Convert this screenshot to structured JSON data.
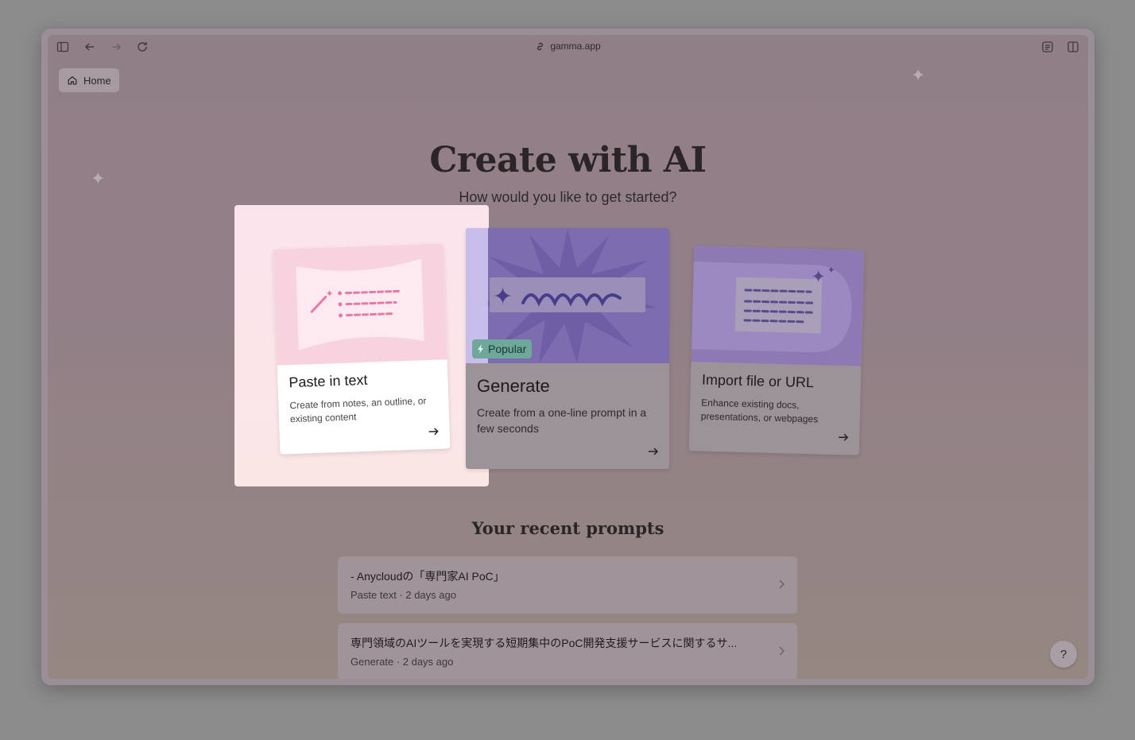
{
  "browser": {
    "url": "gamma.app"
  },
  "nav": {
    "home_label": "Home"
  },
  "hero": {
    "title": "Create with AI",
    "subtitle": "How would you like to get started?"
  },
  "cards": [
    {
      "title": "Paste in text",
      "description": "Create from notes, an outline, or existing content"
    },
    {
      "title": "Generate",
      "description": "Create from a one-line prompt in a few seconds",
      "badge": "Popular"
    },
    {
      "title": "Import file or URL",
      "description": "Enhance existing docs, presentations, or webpages"
    }
  ],
  "recent": {
    "title": "Your recent prompts",
    "items": [
      {
        "title": "- Anycloudの「専門家AI PoC」",
        "meta": "Paste text · 2 days ago"
      },
      {
        "title": "専門領域のAIツールを実現する短期集中のPoC開発支援サービスに関するサ...",
        "meta": "Generate · 2 days ago"
      }
    ]
  },
  "help": {
    "label": "?"
  },
  "colors": {
    "accent_purple": "#7c6db0",
    "paste_pink": "#f7d3e0",
    "popular_green": "#6fa89a"
  }
}
